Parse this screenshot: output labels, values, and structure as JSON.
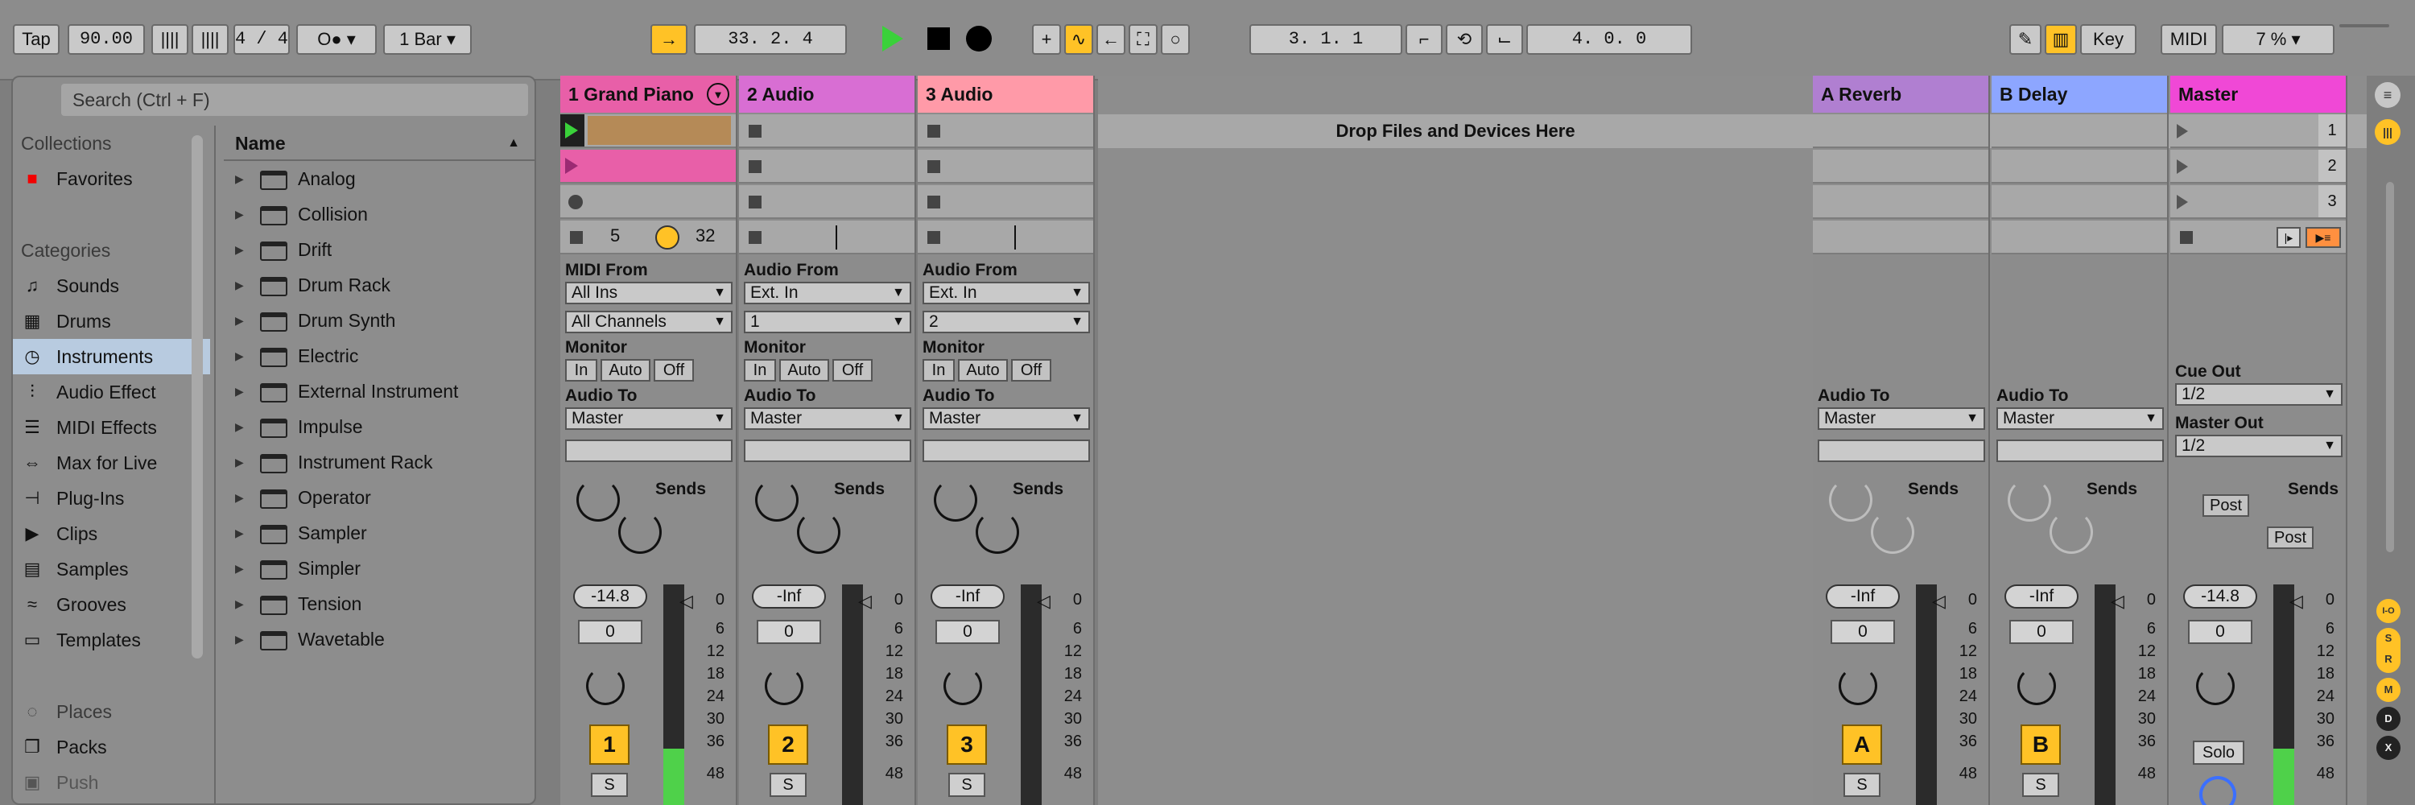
{
  "transport": {
    "tap": "Tap",
    "tempo": "90.00",
    "signature": "4 / 4",
    "metro": "O●",
    "quantize": "1 Bar",
    "position": "33.  2.  4",
    "loop_start": "3.  1.  1",
    "loop_length": "4.  0.  0",
    "key": "Key",
    "midi": "MIDI",
    "cpu": "7 %"
  },
  "browser": {
    "search_placeholder": "Search (Ctrl + F)",
    "collections_header": "Collections",
    "favorites": "Favorites",
    "categories_header": "Categories",
    "categories": [
      "Sounds",
      "Drums",
      "Instruments",
      "Audio Effect",
      "MIDI Effects",
      "Max for Live",
      "Plug-Ins",
      "Clips",
      "Samples",
      "Grooves",
      "Templates"
    ],
    "places_header": "Places",
    "places": [
      "Packs",
      "Push"
    ],
    "name_header": "Name",
    "items": [
      "Analog",
      "Collision",
      "Drift",
      "Drum Rack",
      "Drum Synth",
      "Electric",
      "External Instrument",
      "Impulse",
      "Instrument Rack",
      "Operator",
      "Sampler",
      "Simpler",
      "Tension",
      "Wavetable"
    ]
  },
  "drop_text": "Drop Files and Devices Here",
  "tracks": [
    {
      "name": "1 Grand Piano",
      "color": "#e85fa8",
      "from_label": "MIDI From",
      "from": "All Ins",
      "channel": "All Channels",
      "vol": "-14.8",
      "pan": "0",
      "num": "1",
      "solo": "S",
      "top_a": "5",
      "top_b": "32"
    },
    {
      "name": "2 Audio",
      "color": "#d86ed3",
      "from_label": "Audio From",
      "from": "Ext. In",
      "channel": "1",
      "vol": "-Inf",
      "pan": "0",
      "num": "2",
      "solo": "S"
    },
    {
      "name": "3 Audio",
      "color": "#ff9aa8",
      "from_label": "Audio From",
      "from": "Ext. In",
      "channel": "2",
      "vol": "-Inf",
      "pan": "0",
      "num": "3",
      "solo": "S"
    }
  ],
  "returns": [
    {
      "name": "A Reverb",
      "color": "#b07fd1",
      "to": "Master",
      "vol": "-Inf",
      "pan": "0",
      "num": "A",
      "solo": "S"
    },
    {
      "name": "B Delay",
      "color": "#8da6ff",
      "to": "Master",
      "vol": "-Inf",
      "pan": "0",
      "num": "B",
      "solo": "S"
    }
  ],
  "master": {
    "name": "Master",
    "color": "#f048d6",
    "scenes": [
      "1",
      "2",
      "3"
    ],
    "cue_out_label": "Cue Out",
    "cue_out": "1/2",
    "master_out_label": "Master Out",
    "master_out": "1/2",
    "post": "Post",
    "vol": "-14.8",
    "pan": "0",
    "solo": "Solo"
  },
  "labels": {
    "monitor": "Monitor",
    "in": "In",
    "auto": "Auto",
    "off": "Off",
    "audio_to": "Audio To",
    "master": "Master",
    "sends": "Sends"
  },
  "scale": [
    "0",
    "6",
    "12",
    "18",
    "24",
    "30",
    "36",
    "48"
  ],
  "side_buttons": [
    "I-O",
    "S",
    "R",
    "M",
    "D",
    "X"
  ]
}
